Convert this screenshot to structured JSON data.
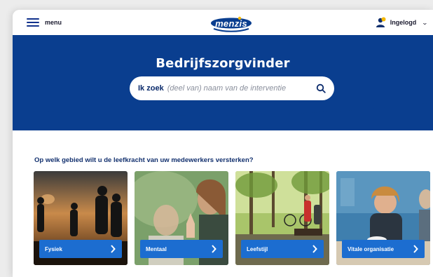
{
  "header": {
    "menu_label": "menu",
    "logo_text": "menzis",
    "login_label": "Ingelogd",
    "icons": {
      "menu": "hamburger-icon",
      "user": "user-icon",
      "chevron": "chevron-down-icon"
    }
  },
  "hero": {
    "title": "Bedrijfszorgvinder",
    "search": {
      "prefix": "Ik zoek",
      "placeholder": "(deel van) naam van de interventie",
      "icon": "search-icon"
    }
  },
  "main": {
    "question": "Op welk gebied wilt u de leefkracht van uw medewerkers versterken?",
    "cards": [
      {
        "label": "Fysiek"
      },
      {
        "label": "Mentaal"
      },
      {
        "label": "Leefstijl"
      },
      {
        "label": "Vitale organisatie"
      }
    ]
  },
  "colors": {
    "brand_blue": "#0a3e8f",
    "button_blue": "#1c6dd0",
    "logo_yellow": "#f5b800"
  }
}
